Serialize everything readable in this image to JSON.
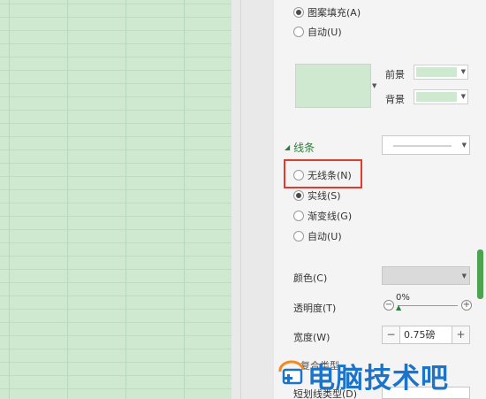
{
  "fill": {
    "pattern_fill_label": "图案填充(A)",
    "auto_label": "自动(U)",
    "foreground_label": "前景",
    "background_label": "背景"
  },
  "line": {
    "section_title": "线条",
    "options": [
      {
        "label": "无线条(N)",
        "checked": false
      },
      {
        "label": "实线(S)",
        "checked": true
      },
      {
        "label": "渐变线(G)",
        "checked": false
      },
      {
        "label": "自动(U)",
        "checked": false
      }
    ]
  },
  "properties": {
    "color_label": "颜色(C)",
    "transparency_label": "透明度(T)",
    "transparency_value": "0%",
    "width_label": "宽度(W)",
    "width_value": "0.75磅",
    "dash_type_label": "短划线类型(D)",
    "compound_type_label": "复合类型"
  },
  "watermark": {
    "text": "电脑技术吧"
  },
  "colors": {
    "accent_green": "#2f7d3a",
    "fill_green": "#cfe9d1",
    "highlight_red": "#e23b2e",
    "watermark_blue": "#1b74c9"
  }
}
